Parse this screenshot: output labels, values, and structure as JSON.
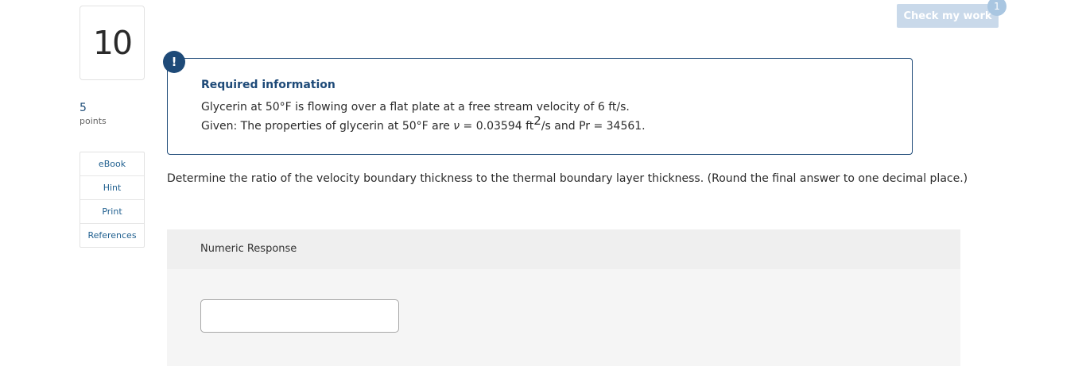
{
  "question": {
    "number": "10",
    "points_value": "5",
    "points_label": "points",
    "prompt": "Determine the ratio of the velocity boundary thickness to the thermal boundary layer thickness. (Round the final answer to one decimal place.)"
  },
  "side_menu": {
    "items": [
      {
        "label": "eBook"
      },
      {
        "label": "Hint"
      },
      {
        "label": "Print"
      },
      {
        "label": "References"
      }
    ]
  },
  "toolbar": {
    "check_label": "Check my work",
    "check_badge": "1"
  },
  "info_box": {
    "icon": "!",
    "title": "Required information",
    "line1": "Glycerin at 50°F is flowing over a flat plate at a free stream velocity of 6 ft/s.",
    "line2": {
      "prefix": "Given: The properties of glycerin at 50°F are ",
      "nu_symbol": "ν",
      "mid": " = 0.03594 ft",
      "sup": "2",
      "suffix": "/s and Pr = 34561."
    }
  },
  "response": {
    "header": "Numeric Response",
    "input_value": ""
  }
}
